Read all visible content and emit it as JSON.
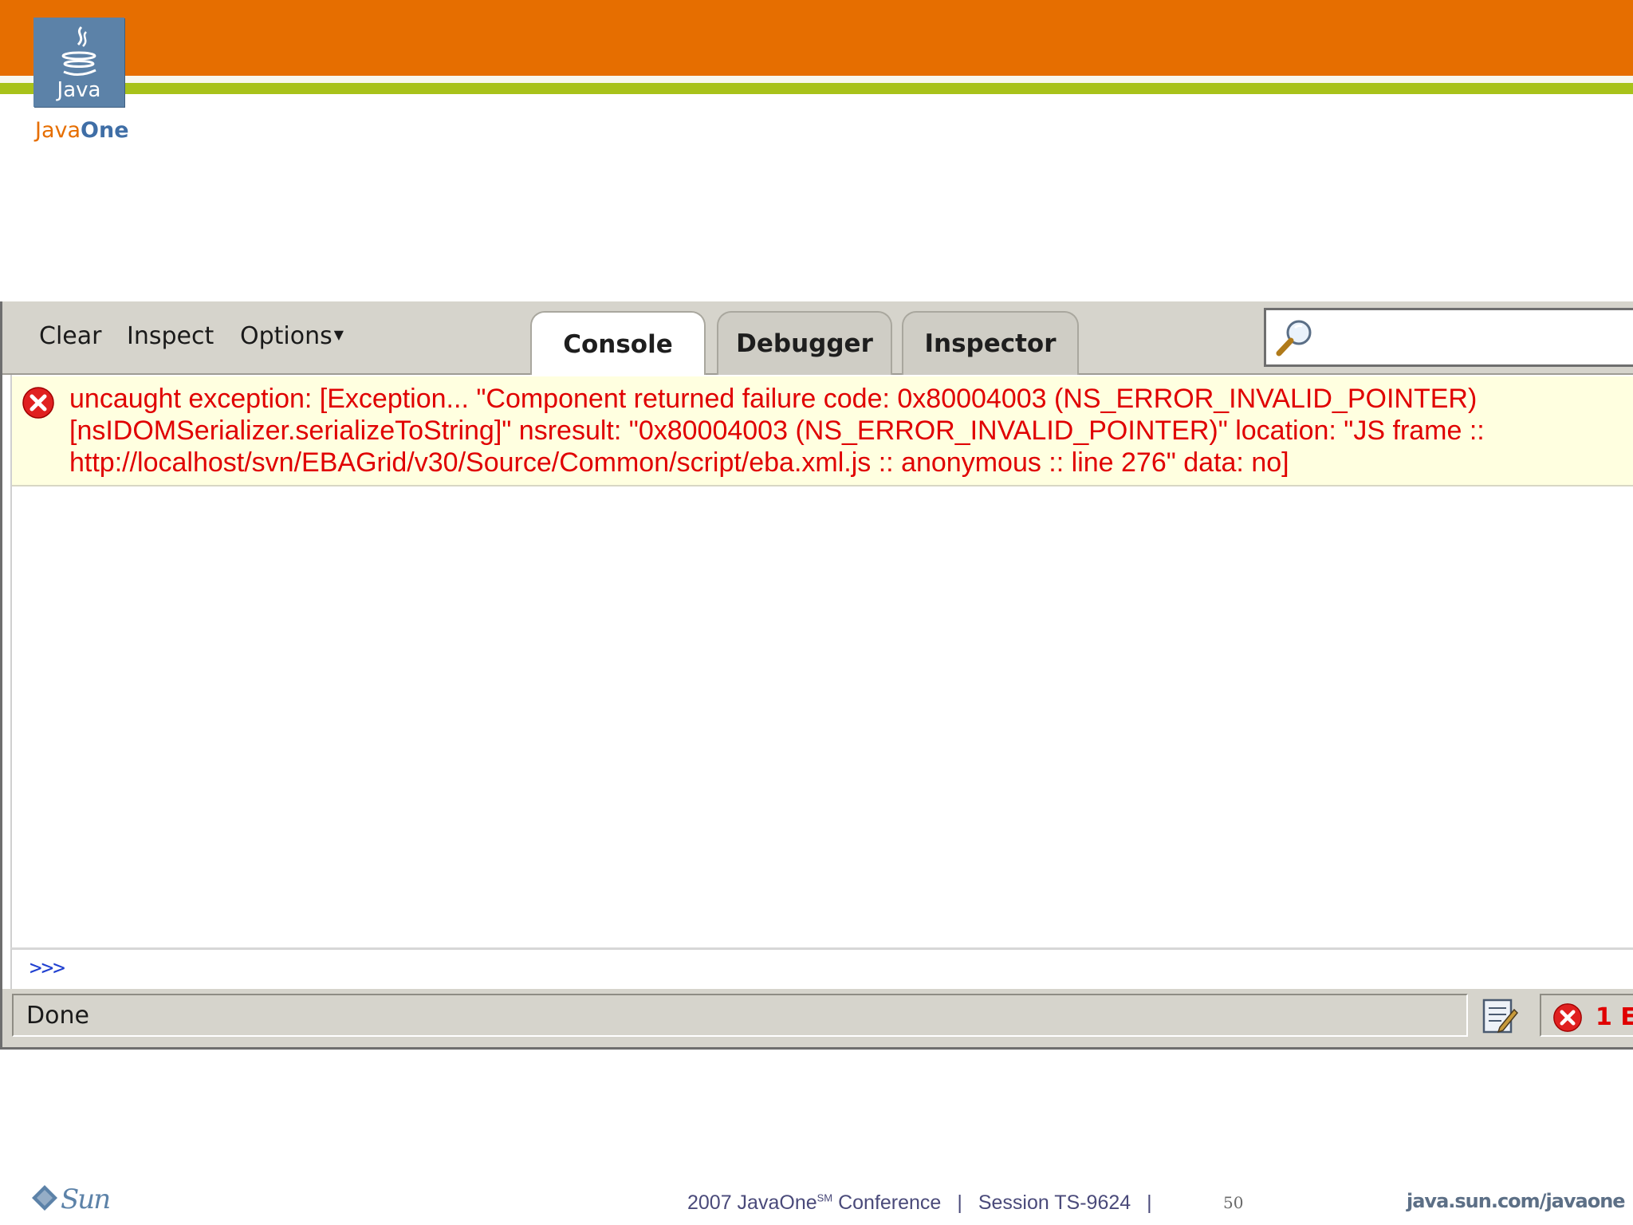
{
  "slide": {
    "colors": {
      "orange": "#e66e00",
      "green": "#a8c21a",
      "java_blue": "#5c82a8"
    },
    "logo_text": "Java",
    "wordmark_part1": "Java",
    "wordmark_part2": "One"
  },
  "firebug": {
    "toolbar": {
      "clear_label": "Clear",
      "inspect_label": "Inspect",
      "options_label": "Options"
    },
    "tabs": [
      {
        "label": "Console",
        "active": true
      },
      {
        "label": "Debugger",
        "active": false
      },
      {
        "label": "Inspector",
        "active": false
      }
    ],
    "search": {
      "icon": "magnifier-icon",
      "value": ""
    },
    "console": {
      "error_icon": "error-icon",
      "error_color": "#e00000",
      "error_message": "uncaught exception: [Exception... \"Component returned failure code: 0x80004003 (NS_ERROR_INVALID_POINTER) [nsIDOMSerializer.serializeToString]\" nsresult: \"0x80004003 (NS_ERROR_INVALID_POINTER)\" location: \"JS frame :: http://localhost/svn/EBAGrid/v30/Source/Common/script/eba.xml.js :: anonymous :: line 276\" data: no]"
    },
    "command_line": {
      "prompt": ">>>",
      "value": ""
    },
    "statusbar": {
      "status_text": "Done",
      "errors_text": "1 E"
    }
  },
  "footer": {
    "sun_logo_text": "Sun",
    "conference": "2007 JavaOne",
    "conference_sup": "SM",
    "conference_suffix": "Conference",
    "separator": "|",
    "session": "Session TS-9624",
    "page_number": "50",
    "url": "java.sun.com/javaone"
  }
}
